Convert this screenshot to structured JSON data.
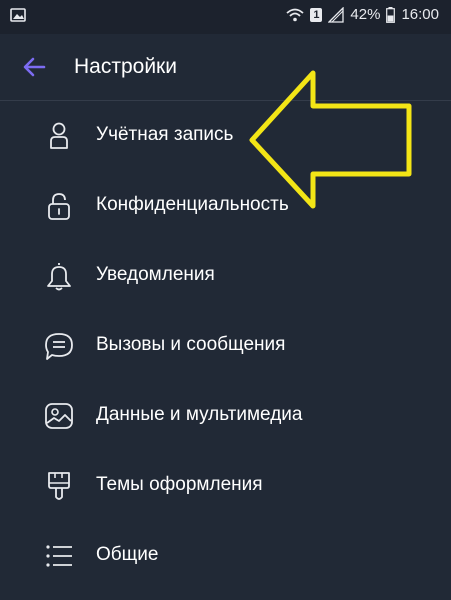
{
  "status_bar": {
    "battery": "42%",
    "time": "16:00",
    "sim": "1",
    "icons": [
      "gallery-icon",
      "wifi-icon",
      "sim-icon",
      "signal-icon",
      "battery-icon"
    ]
  },
  "header": {
    "title": "Настройки",
    "back_icon": "arrow-left-icon",
    "accent": "#7c6cf2"
  },
  "menu": [
    {
      "label": "Учётная запись",
      "icon": "person-icon"
    },
    {
      "label": "Конфиденциальность",
      "icon": "lock-icon"
    },
    {
      "label": "Уведомления",
      "icon": "bell-icon"
    },
    {
      "label": "Вызовы и сообщения",
      "icon": "chat-bubble-icon"
    },
    {
      "label": "Данные и мультимедиа",
      "icon": "image-icon"
    },
    {
      "label": "Темы оформления",
      "icon": "paint-brush-icon"
    },
    {
      "label": "Общие",
      "icon": "list-icon"
    }
  ],
  "annotation": {
    "color": "#f3e516",
    "shape": "arrow-left"
  }
}
